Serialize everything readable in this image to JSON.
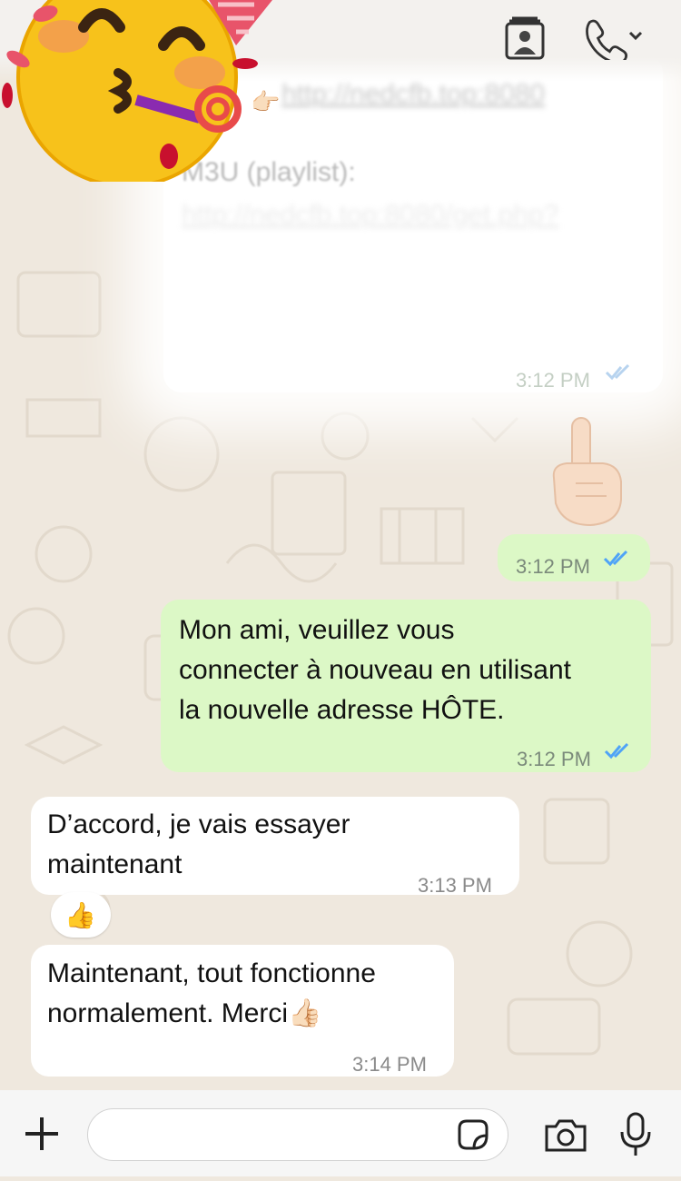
{
  "header": {
    "contact_card_icon": "contact-card-icon",
    "call_icon": "phone-icon"
  },
  "messages": [
    {
      "direction": "outgoing",
      "partial_link_top": "http://nedcfb.top:8080",
      "label": "M3U (playlist):",
      "blurred_link": "http://nedcfb.top:8080/get.php?",
      "time": "3:12 PM",
      "status": "read"
    },
    {
      "direction": "outgoing",
      "emoji": "☝🏻",
      "time": "3:12 PM",
      "status": "read"
    },
    {
      "direction": "outgoing",
      "lines": [
        "Mon ami, veuillez vous",
        "connecter à nouveau en utilisant",
        "la nouvelle adresse HÔTE."
      ],
      "time": "3:12 PM",
      "status": "read"
    },
    {
      "direction": "incoming",
      "lines": [
        "D’accord, je vais essayer",
        "maintenant"
      ],
      "time": "3:13 PM",
      "reaction": "👍"
    },
    {
      "direction": "incoming",
      "lines": [
        "Maintenant, tout fonctionne",
        "normalement. Merci"
      ],
      "emoji": "👍🏻",
      "time": "3:14 PM"
    }
  ],
  "composer": {
    "placeholder": "",
    "plus_icon": "plus-icon",
    "sticker_icon": "sticker-icon",
    "camera_icon": "camera-icon",
    "mic_icon": "microphone-icon"
  },
  "colors": {
    "outgoing_bubble": "#dcf8c6",
    "incoming_bubble": "#ffffff",
    "read_ticks": "#4fa3f7",
    "wallpaper": "#efe8de"
  }
}
